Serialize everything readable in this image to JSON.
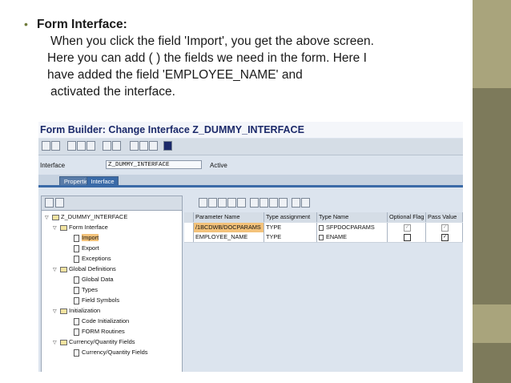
{
  "slide": {
    "bullet": "•",
    "heading": "Form Interface:",
    "lines": [
      "When you click the field 'Import', you get the above screen.",
      "Here you can add ( ) the  fields we need in the form. Here I",
      "have added the field 'EMPLOYEE_NAME' and",
      "activated the interface."
    ]
  },
  "sap": {
    "title": "Form Builder: Change Interface Z_DUMMY_INTERFACE",
    "interface_label": "Interface",
    "interface_value": "Z_DUMMY_INTERFACE",
    "status": "Active",
    "tabs": [
      "Properties",
      "Interface"
    ],
    "tree": [
      {
        "label": "Z_DUMMY_INTERFACE",
        "type": "folder",
        "level": 0
      },
      {
        "label": "Form Interface",
        "type": "folder",
        "level": 1
      },
      {
        "label": "Import",
        "type": "doc",
        "level": 2,
        "selected": true
      },
      {
        "label": "Export",
        "type": "doc",
        "level": 2
      },
      {
        "label": "Exceptions",
        "type": "doc",
        "level": 2
      },
      {
        "label": "Global Definitions",
        "type": "folder",
        "level": 1
      },
      {
        "label": "Global Data",
        "type": "doc",
        "level": 2
      },
      {
        "label": "Types",
        "type": "doc",
        "level": 2
      },
      {
        "label": "Field Symbols",
        "type": "doc",
        "level": 2
      },
      {
        "label": "Initialization",
        "type": "folder",
        "level": 1
      },
      {
        "label": "Code Initialization",
        "type": "doc",
        "level": 2
      },
      {
        "label": "FORM Routines",
        "type": "doc",
        "level": 2
      },
      {
        "label": "Currency/Quantity Fields",
        "type": "folder",
        "level": 1
      },
      {
        "label": "Currency/Quantity Fields",
        "type": "doc",
        "level": 2
      }
    ],
    "grid": {
      "columns": [
        "Parameter Name",
        "Type assignment",
        "Type Name",
        "Optional Flag",
        "Pass Value"
      ],
      "rows": [
        {
          "param": "/1BCDWB/DOCPARAMS",
          "assign": "TYPE",
          "type_name": "SFPDOCPARAMS",
          "optional": true,
          "pass": true,
          "disabled": true
        },
        {
          "param": "EMPLOYEE_NAME",
          "assign": "TYPE",
          "type_name": "ENAME",
          "optional": false,
          "pass": true,
          "disabled": false
        }
      ]
    }
  },
  "colors": {
    "band": "#7d7a5b",
    "band_accent": "#a9a47c",
    "title_text": "#1c2a6a",
    "selection": "#f3c27a"
  }
}
